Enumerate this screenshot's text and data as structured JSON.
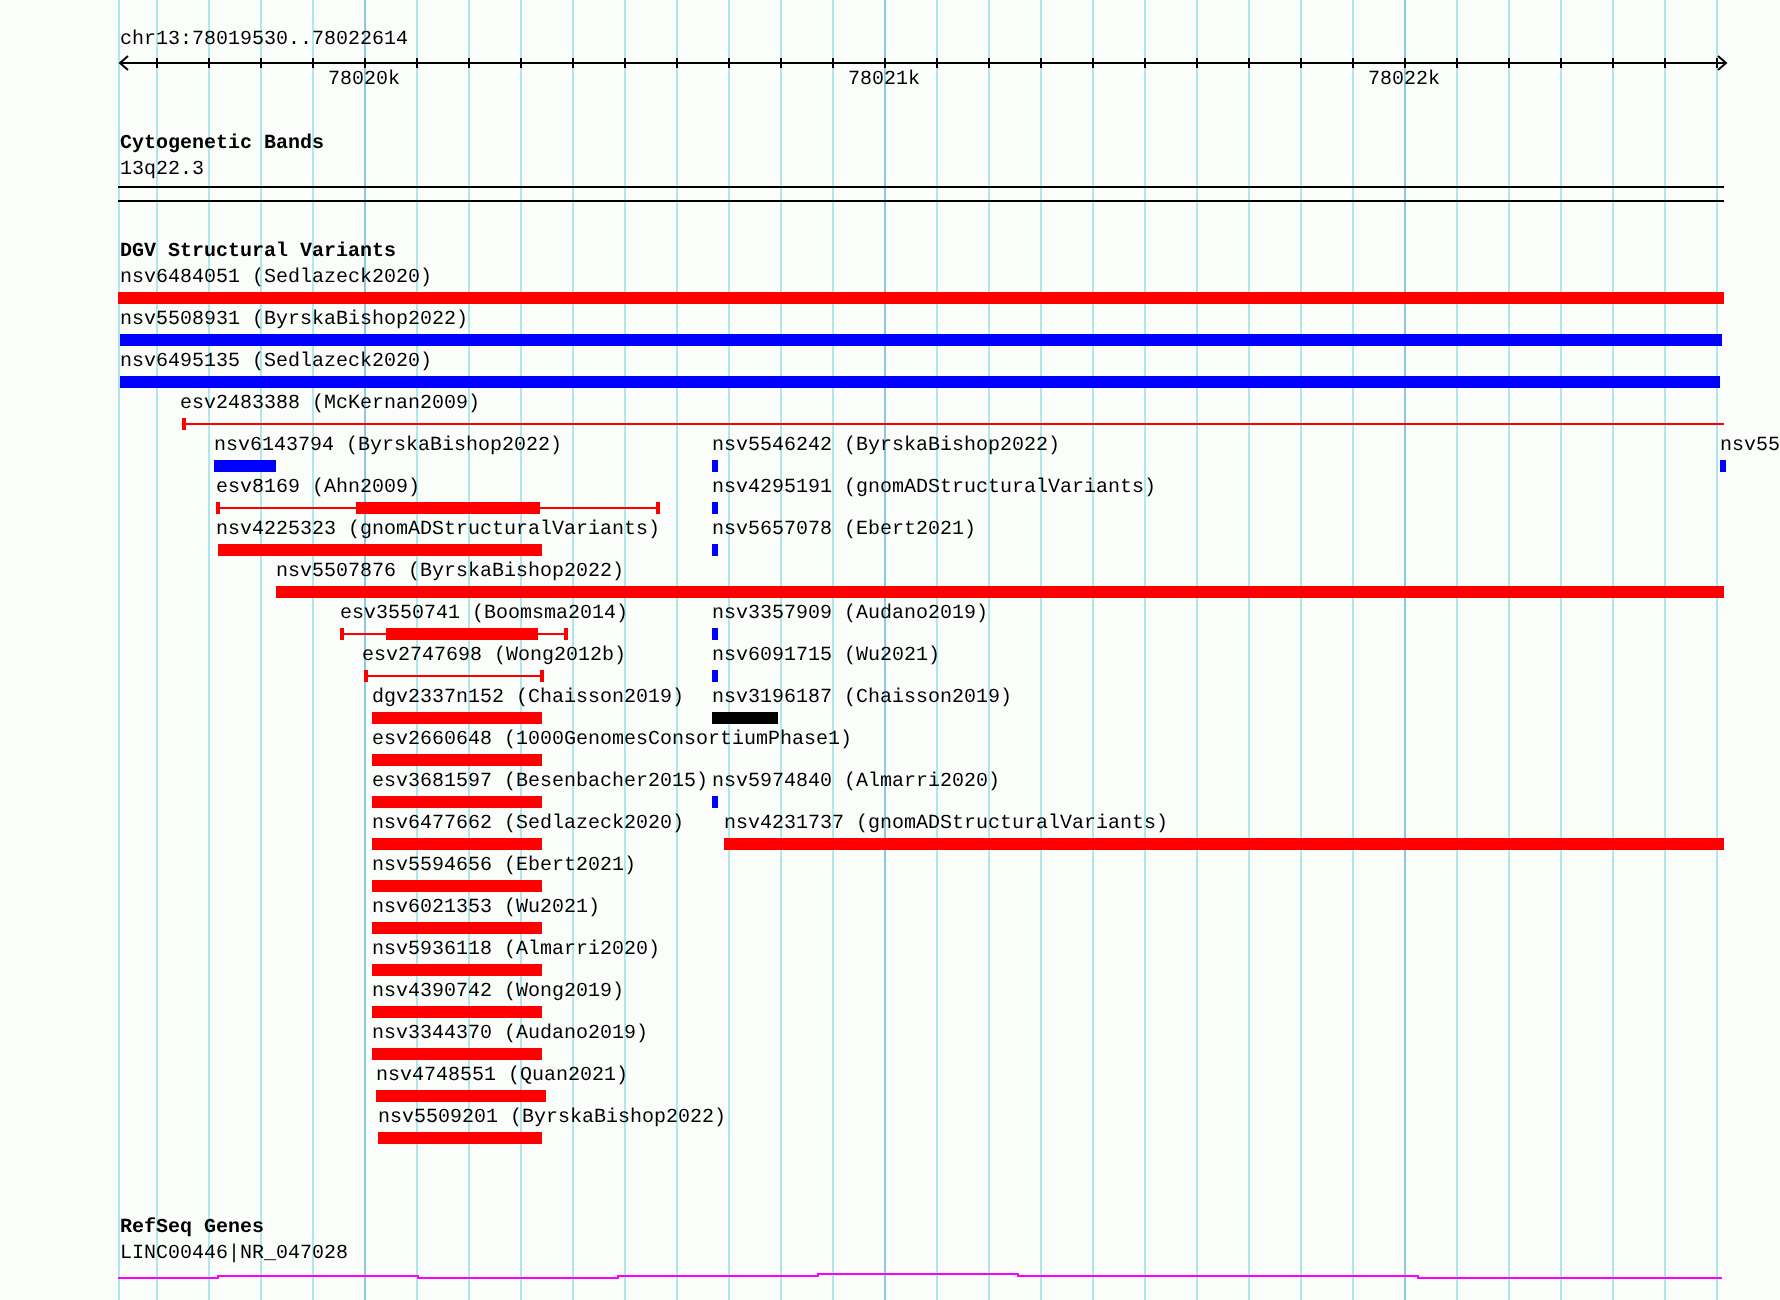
{
  "ruler": {
    "location": "chr13:78019530..78022614",
    "ticks": [
      "78020k",
      "78021k",
      "78022k"
    ]
  },
  "cytogenetic_bands": {
    "title": "Cytogenetic Bands",
    "band": "13q22.3"
  },
  "dgv": {
    "title": "DGV Structural Variants",
    "variants": [
      {
        "label": "nsv6484051 (Sedlazeck2020)",
        "kind": "bar",
        "color": "#ff0000"
      },
      {
        "label": "nsv5508931 (ByrskaBishop2022)",
        "kind": "bar",
        "color": "#0000ff"
      },
      {
        "label": "nsv6495135 (Sedlazeck2020)",
        "kind": "bar",
        "color": "#0000ff"
      },
      {
        "label": "esv2483388 (McKernan2009)",
        "kind": "span",
        "color": "#ff0000"
      },
      {
        "label": "nsv6143794 (ByrskaBishop2022)",
        "kind": "bar",
        "color": "#0000ff"
      },
      {
        "label": "nsv5546242 (ByrskaBishop2022)",
        "kind": "bar",
        "color": "#0000ff"
      },
      {
        "label": "nsv55",
        "kind": "bar",
        "color": "#0000ff"
      },
      {
        "label": "esv8169 (Ahn2009)",
        "kind": "span",
        "color": "#ff0000"
      },
      {
        "label": "nsv4295191 (gnomADStructuralVariants)",
        "kind": "bar",
        "color": "#0000ff"
      },
      {
        "label": "nsv4225323 (gnomADStructuralVariants)",
        "kind": "bar",
        "color": "#ff0000"
      },
      {
        "label": "nsv5657078 (Ebert2021)",
        "kind": "bar",
        "color": "#0000ff"
      },
      {
        "label": "nsv5507876 (ByrskaBishop2022)",
        "kind": "bar",
        "color": "#ff0000"
      },
      {
        "label": "esv3550741 (Boomsma2014)",
        "kind": "span",
        "color": "#ff0000"
      },
      {
        "label": "nsv3357909 (Audano2019)",
        "kind": "bar",
        "color": "#0000ff"
      },
      {
        "label": "esv2747698 (Wong2012b)",
        "kind": "span",
        "color": "#ff0000"
      },
      {
        "label": "nsv6091715 (Wu2021)",
        "kind": "bar",
        "color": "#0000ff"
      },
      {
        "label": "dgv2337n152 (Chaisson2019)",
        "kind": "bar",
        "color": "#ff0000"
      },
      {
        "label": "nsv3196187 (Chaisson2019)",
        "kind": "bar",
        "color": "#000000"
      },
      {
        "label": "esv2660648 (1000GenomesConsortiumPhase1)",
        "kind": "bar",
        "color": "#ff0000"
      },
      {
        "label": "esv3681597 (Besenbacher2015)",
        "kind": "bar",
        "color": "#ff0000"
      },
      {
        "label": "nsv5974840 (Almarri2020)",
        "kind": "bar",
        "color": "#0000ff"
      },
      {
        "label": "nsv6477662 (Sedlazeck2020)",
        "kind": "bar",
        "color": "#ff0000"
      },
      {
        "label": "nsv4231737 (gnomADStructuralVariants)",
        "kind": "bar",
        "color": "#ff0000"
      },
      {
        "label": "nsv5594656 (Ebert2021)",
        "kind": "bar",
        "color": "#ff0000"
      },
      {
        "label": "nsv6021353 (Wu2021)",
        "kind": "bar",
        "color": "#ff0000"
      },
      {
        "label": "nsv5936118 (Almarri2020)",
        "kind": "bar",
        "color": "#ff0000"
      },
      {
        "label": "nsv4390742 (Wong2019)",
        "kind": "bar",
        "color": "#ff0000"
      },
      {
        "label": "nsv3344370 (Audano2019)",
        "kind": "bar",
        "color": "#ff0000"
      },
      {
        "label": "nsv4748551 (Quan2021)",
        "kind": "bar",
        "color": "#ff0000"
      },
      {
        "label": "nsv5509201 (ByrskaBishop2022)",
        "kind": "bar",
        "color": "#ff0000"
      }
    ]
  },
  "refseq_genes": {
    "title": "RefSeq Genes",
    "gene": "LINC00446|NR_047028"
  }
}
